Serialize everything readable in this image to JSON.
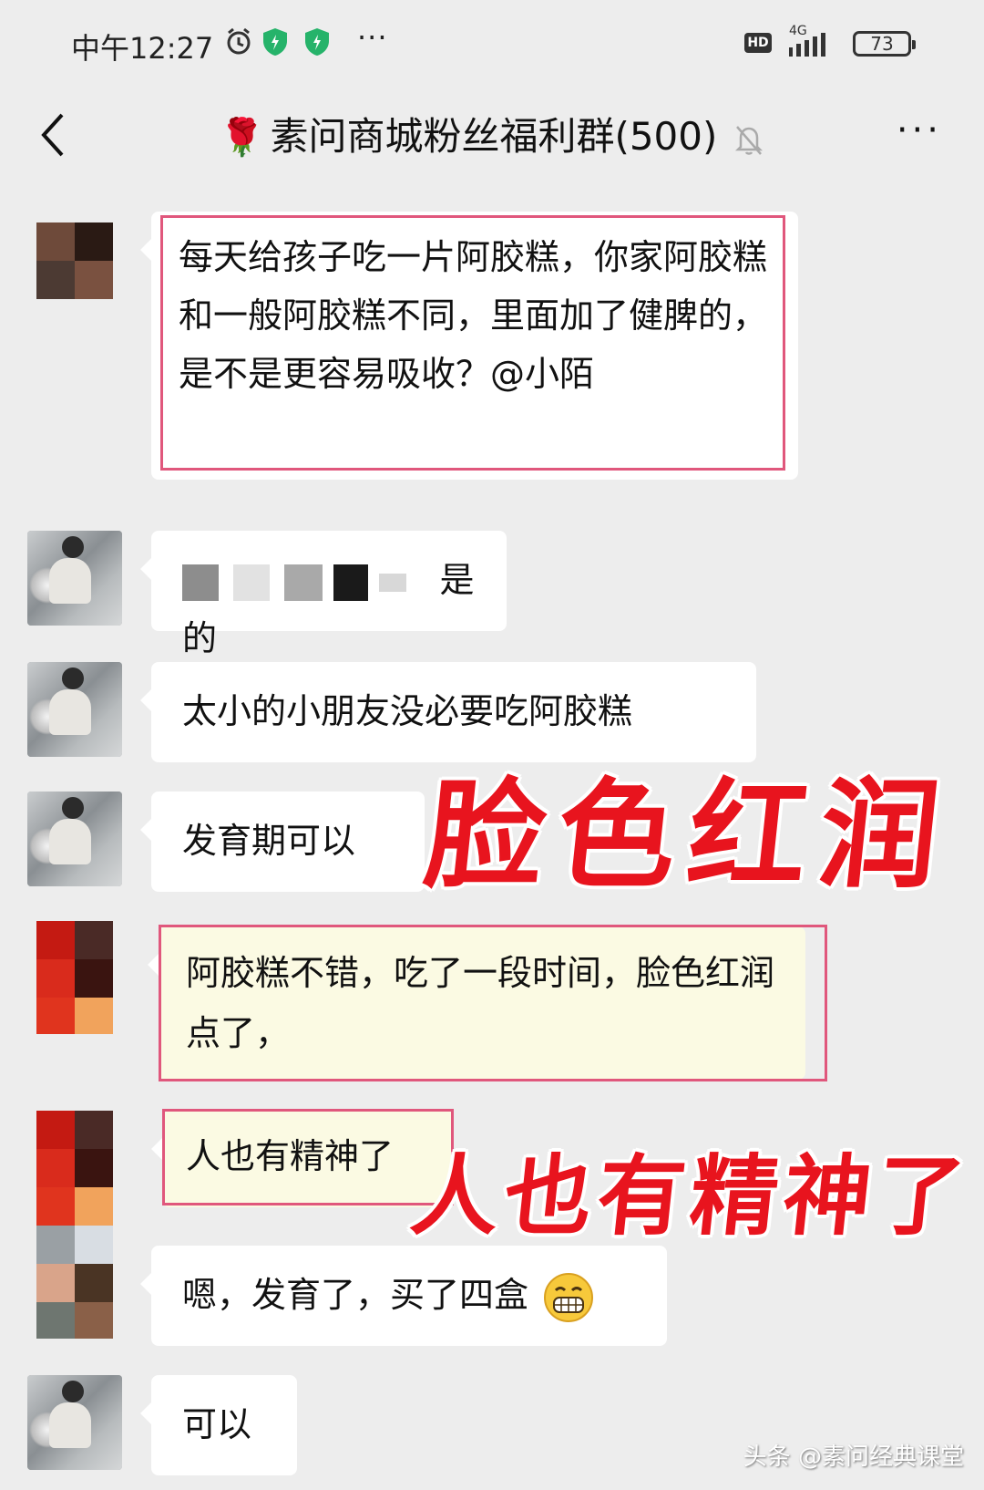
{
  "status_bar": {
    "time": "中午12:27",
    "network_type": "4G",
    "hd_label": "HD",
    "battery": "73",
    "more": "···"
  },
  "header": {
    "title": "素问商城粉丝福利群(500)",
    "title_icon": "rose-emoji",
    "more": "···"
  },
  "messages": [
    {
      "text": "每天给孩子吃一片阿胶糕，你家阿胶糕和一般阿胶糕不同，里面加了健脾的，是不是更容易吸收？@小陌"
    },
    {
      "text": "是的"
    },
    {
      "text": "太小的小朋友没必要吃阿胶糕"
    },
    {
      "text": "发育期可以"
    },
    {
      "text": "阿胶糕不错，吃了一段时间，脸色红润点了，"
    },
    {
      "text": "人也有精神了"
    },
    {
      "text": "嗯，发育了，买了四盒"
    },
    {
      "text": "可以"
    }
  ],
  "overlays": {
    "caption1": "脸色红润",
    "caption2": "人也有精神了"
  },
  "watermark": "头条 @素问经典课堂",
  "colors": {
    "background": "#ededed",
    "bubble": "#ffffff",
    "highlight_border": "#e0577c",
    "overlay_text": "#e8141e"
  }
}
